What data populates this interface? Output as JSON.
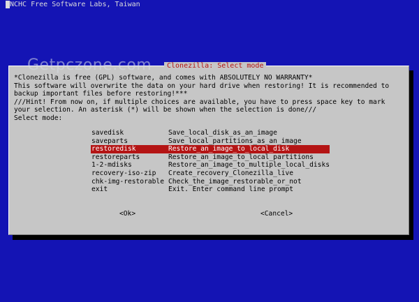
{
  "header": {
    "title": "NCHC Free Software Labs, Taiwan"
  },
  "watermark": {
    "text": "Getpczone.com"
  },
  "dialog": {
    "title": "Clonezilla: Select mode",
    "lines": [
      "*Clonezilla is free (GPL) software, and comes with ABSOLUTELY NO WARRANTY*",
      "This software will overwrite the data on your hard drive when restoring! It is recommended to",
      "backup important files before restoring!***",
      "///Hint! From now on, if multiple choices are available, you have to press space key to mark",
      "your selection. An asterisk (*) will be shown when the selection is done///",
      "Select mode:"
    ],
    "menu": [
      {
        "tag": "savedisk",
        "desc": "Save_local_disk_as_an_image",
        "selected": false
      },
      {
        "tag": "saveparts",
        "desc": "Save_local_partitions_as_an_image",
        "selected": false
      },
      {
        "tag": "restoredisk",
        "desc": "Restore_an_image_to_local_disk",
        "selected": true
      },
      {
        "tag": "restoreparts",
        "desc": "Restore_an_image_to_local_partitions",
        "selected": false
      },
      {
        "tag": "1-2-mdisks",
        "desc": "Restore_an_image_to_multiple_local_disks",
        "selected": false
      },
      {
        "tag": "recovery-iso-zip",
        "desc": "Create_recovery_Clonezilla_live",
        "selected": false
      },
      {
        "tag": "chk-img-restorable",
        "desc": "Check_the_image_restorable_or_not",
        "selected": false
      },
      {
        "tag": "exit",
        "desc": "Exit. Enter command line prompt",
        "selected": false
      }
    ],
    "ok_label": "<Ok>",
    "cancel_label": "<Cancel>"
  },
  "colors": {
    "background": "#1414b4",
    "dialog": "#c6c6c6",
    "highlight": "#b41414",
    "text": "#000000"
  }
}
